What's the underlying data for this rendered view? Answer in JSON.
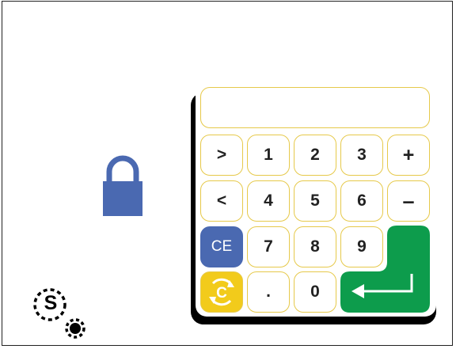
{
  "display": {
    "value": ""
  },
  "keypad": {
    "row1": [
      ">",
      "1",
      "2",
      "3",
      "+"
    ],
    "row2": [
      "<",
      "4",
      "5",
      "6",
      "–"
    ],
    "row3": [
      "CE",
      "7",
      "8",
      "9"
    ],
    "row4": [
      ".",
      "0"
    ]
  },
  "status_indicator": {
    "letter": "S"
  },
  "colors": {
    "lock": "#4a69b1",
    "key_border": "#e6c94a",
    "clear_entry": "#4a69b1",
    "clear_all": "#f2cb1b",
    "enter": "#0d9c4c"
  },
  "icons": {
    "lock": "padlock-icon",
    "clear": "clear-circle-icon",
    "enter": "enter-return-icon",
    "status": "status-s-sun-icon"
  }
}
